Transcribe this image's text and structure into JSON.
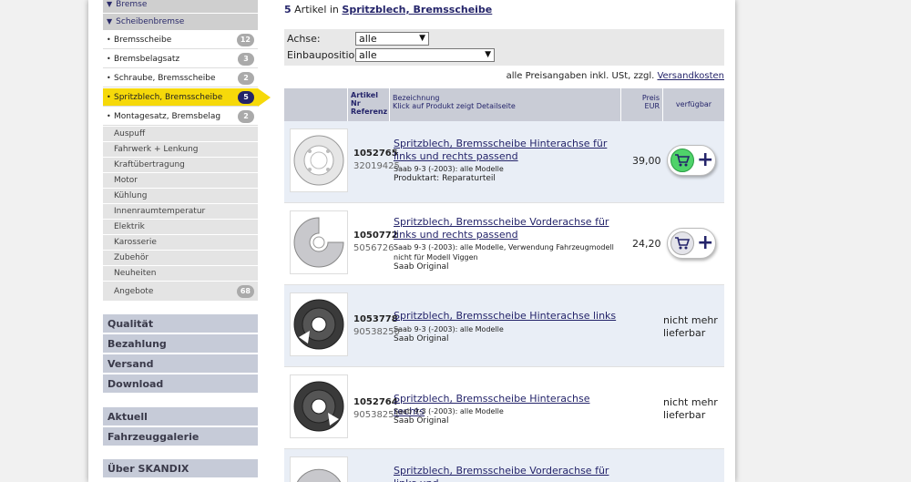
{
  "sidebar": {
    "head1": "Bremse",
    "head2": "Scheibenbremse",
    "subitems": [
      {
        "label": "Bremsscheibe",
        "count": "12"
      },
      {
        "label": "Bremsbelagsatz",
        "count": "3"
      },
      {
        "label": "Schraube, Bremsscheibe",
        "count": "2"
      },
      {
        "label": "Spritzblech, Bremsscheibe",
        "count": "5"
      },
      {
        "label": "Montagesatz, Bremsbelag",
        "count": "2"
      }
    ],
    "categories": [
      {
        "label": "Auspuff"
      },
      {
        "label": "Fahrwerk + Lenkung"
      },
      {
        "label": "Kraftübertragung"
      },
      {
        "label": "Motor"
      },
      {
        "label": "Kühlung"
      },
      {
        "label": "Innenraumtemperatur"
      },
      {
        "label": "Elektrik"
      },
      {
        "label": "Karosserie"
      },
      {
        "label": "Zubehör"
      },
      {
        "label": "Neuheiten"
      },
      {
        "label": "Angebote",
        "count": "68"
      }
    ],
    "blocks": [
      "Qualität",
      "Bezahlung",
      "Versand",
      "Download",
      "Aktuell",
      "Fahrzeuggalerie",
      "Über SKANDIX"
    ]
  },
  "main": {
    "count": "5",
    "count_text": "Artikel in",
    "count_link": "Spritzblech, Bremsscheibe",
    "filter_axle_label": "Achse:",
    "filter_axle_value": "alle",
    "filter_pos_label": "Einbauposition:",
    "filter_pos_value": "alle",
    "price_note": "alle Preisangaben inkl. USt, zzgl.",
    "price_note_link": "Versandkosten",
    "headers": {
      "artikel": "Artikel",
      "nr": "Nr",
      "referenz": "Referenz",
      "bez1": "Bezeichnung",
      "bez2": "Klick auf Produkt zeigt Detailseite",
      "preis": "Preis",
      "eur": "EUR",
      "verf": "verfügbar"
    },
    "products": [
      {
        "artno": "1052765",
        "ref": "32019425",
        "title": "Spritzblech, Bremsscheibe Hinterachse für links und rechts passend",
        "desc": "Saab 9-3 (-2003): alle Modelle",
        "brand": "Produktart: Reparaturteil",
        "price": "39,00",
        "avail": ""
      },
      {
        "artno": "1050772",
        "ref": "5056726",
        "title": "Spritzblech, Bremsscheibe Vorderachse für links und rechts passend",
        "desc": "Saab 9-3 (-2003): alle Modelle, Verwendung Fahrzeugmodell nicht für Modell Viggen",
        "brand": "Saab Original",
        "price": "24,20",
        "avail": ""
      },
      {
        "artno": "1053778",
        "ref": "90538250",
        "title": "Spritzblech, Bremsscheibe Hinterachse links",
        "desc": "Saab 9-3 (-2003): alle Modelle",
        "brand": "Saab Original",
        "price": "",
        "avail": "nicht mehr lieferbar"
      },
      {
        "artno": "1052764",
        "ref": "90538251",
        "title": "Spritzblech, Bremsscheibe Hinterachse rechts",
        "desc": "Saab 9-3 (-2003): alle Modelle",
        "brand": "Saab Original",
        "price": "",
        "avail": "nicht mehr lieferbar"
      },
      {
        "artno": "",
        "ref": "",
        "title": "Spritzblech, Bremsscheibe Vorderachse für links und",
        "desc": "",
        "brand": "",
        "price": "",
        "avail": ""
      }
    ]
  }
}
